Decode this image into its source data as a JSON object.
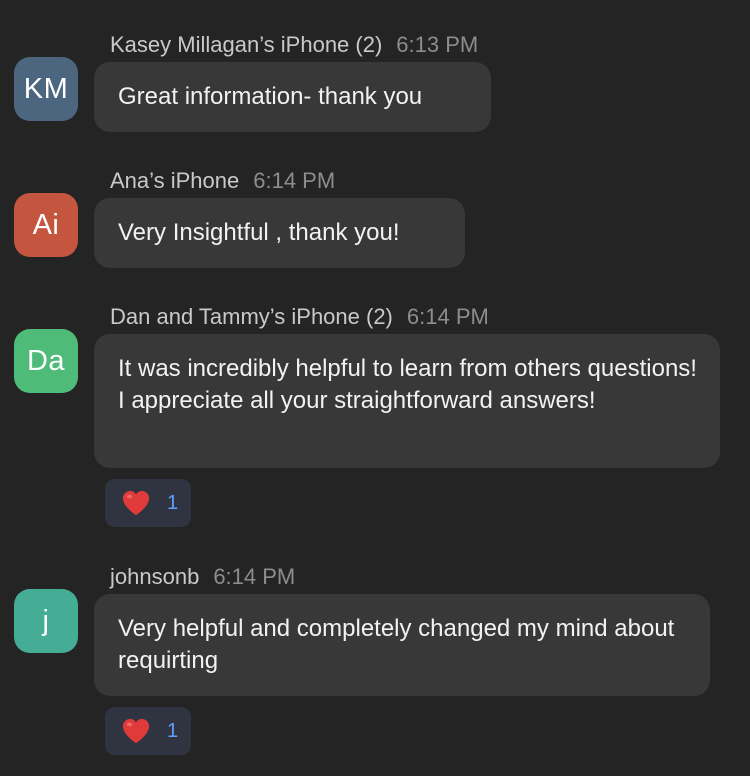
{
  "messages": [
    {
      "sender": "Kasey Millagan’s iPhone (2)",
      "time": "6:13 PM",
      "initials": "KM",
      "avatar_color": "#4d6680",
      "text": "Great information- thank you"
    },
    {
      "sender": "Ana’s iPhone",
      "time": "6:14 PM",
      "initials": "Ai",
      "avatar_color": "#c4553f",
      "text": "Very Insightful , thank you!"
    },
    {
      "sender": "Dan and Tammy’s iPhone (2)",
      "time": "6:14 PM",
      "initials": "Da",
      "avatar_color": "#4fbb78",
      "text": "It was incredibly helpful to learn from others questions!  I appreciate all your straightforward answers!",
      "reaction": {
        "emoji": "heart",
        "count": "1"
      }
    },
    {
      "sender": "johnsonb",
      "time": "6:14 PM",
      "initials": "j",
      "avatar_color": "#45ad96",
      "text": "Very helpful and completely changed my mind about requirting",
      "reaction": {
        "emoji": "heart",
        "count": "1"
      }
    }
  ],
  "colors": {
    "background": "#242424",
    "bubble": "#383838",
    "reaction_bg": "#2f3440",
    "reaction_count": "#5fa0ff",
    "heart": "#e03a3a"
  }
}
